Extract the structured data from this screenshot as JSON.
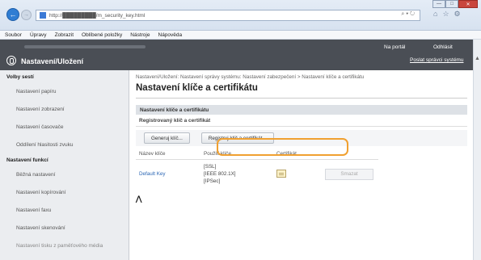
{
  "browser": {
    "url": "http://█████████/m_security_key.html",
    "address_tools": "⌕ ▾ ↻",
    "tab_icons": [
      "⌂",
      "☆",
      "⚙"
    ],
    "window_controls": [
      "—",
      "□",
      "✕"
    ]
  },
  "menubar": [
    "Soubor",
    "Úpravy",
    "Zobrazit",
    "Oblíbené položky",
    "Nástroje",
    "Nápověda"
  ],
  "appbar": {
    "title": "Nastavení/Uložení",
    "portal": "Na portál",
    "logout": "Odhlásit",
    "mail_admin": "Poslat správci systému"
  },
  "sidebar": {
    "sections": [
      {
        "title": "Volby sestí",
        "items": [
          "Nastavení papíru",
          "Nastavení zobrazení",
          "Nastavení časovače",
          "Oddílení hlasitosti zvuku"
        ]
      },
      {
        "title": "Nastavení funkcí",
        "items": [
          "Běžná nastavení",
          "Nastavení kopírování",
          "Nastavení faxu",
          "Nastavení skenování",
          "Nastavení tisku z paměťového média"
        ]
      }
    ]
  },
  "main": {
    "breadcrumb": "Nastavení/Uložení: Nastavení správy systému: Nastavení zabezpečení > Nastavení klíče a certifikátu",
    "title": "Nastavení klíče a certifikátu",
    "section": "Nastavení klíče a certifikátu",
    "subsection": "Registrovaný klíč a certifikát",
    "buttons": {
      "generate": "Generuj klíč...",
      "register": "Registruj klíč a certifikát..."
    },
    "table": {
      "headers": [
        "Název klíče",
        "Použití klíče",
        "Certifikát",
        ""
      ],
      "rows": [
        {
          "name": "Default Key",
          "usage": [
            "[SSL]",
            "[IEEE 802.1X]",
            "[IPSec]"
          ],
          "delete": "Smazat"
        }
      ]
    }
  }
}
